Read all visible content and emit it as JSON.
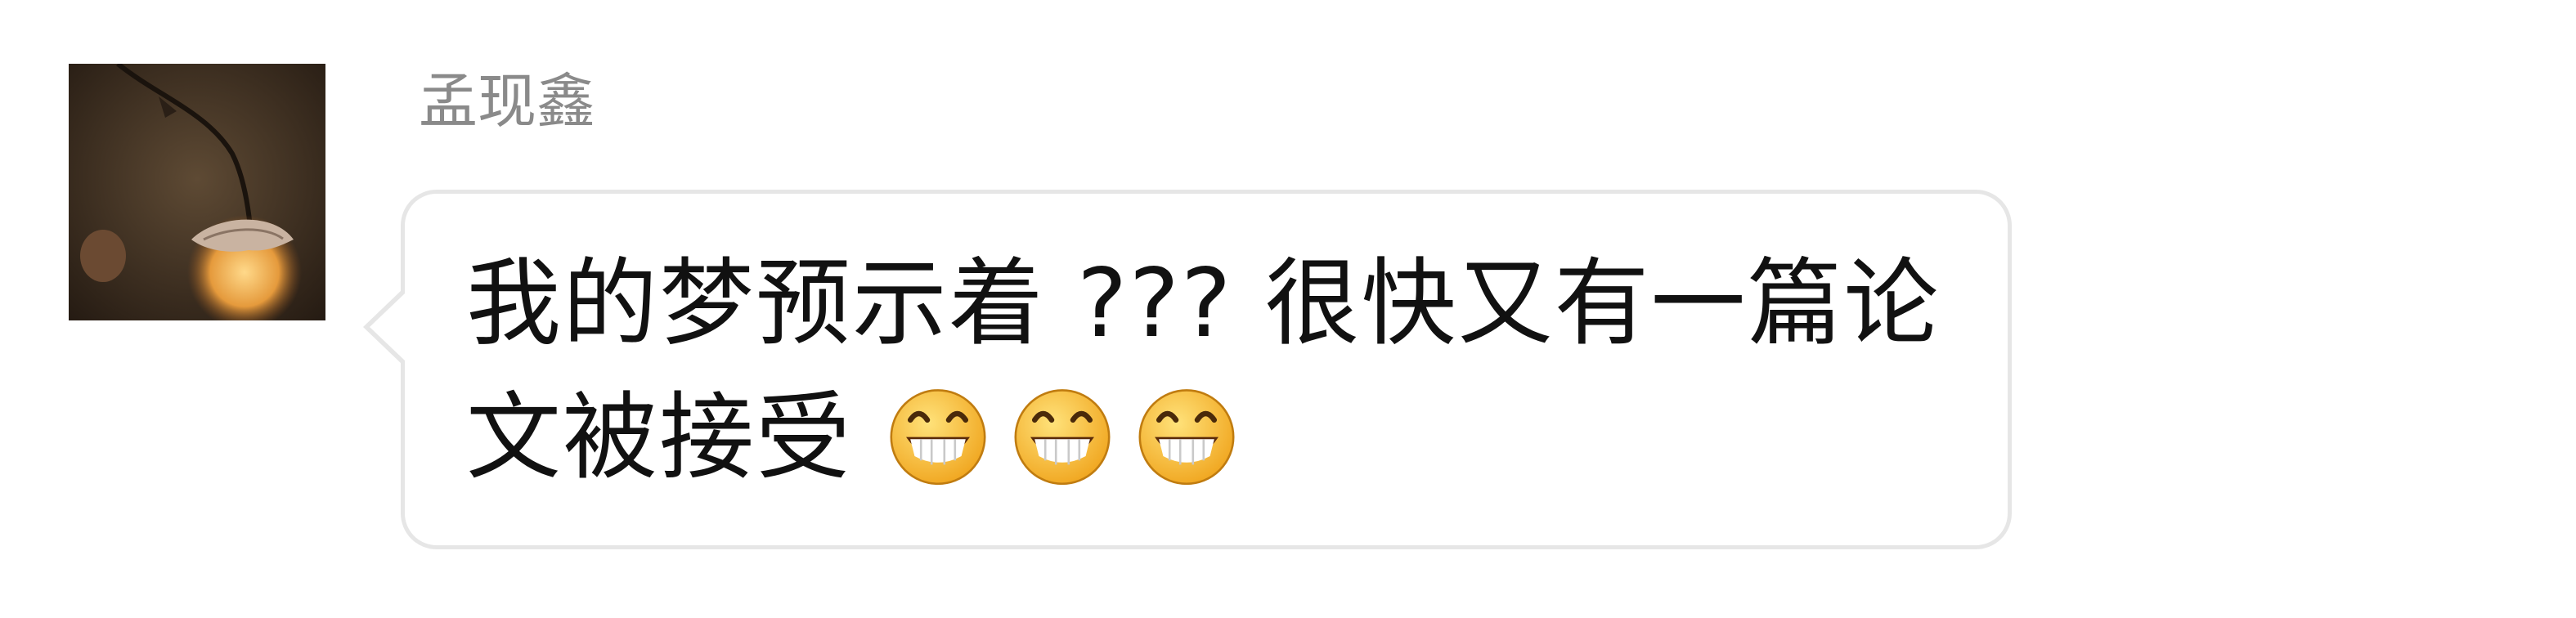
{
  "message": {
    "sender_name": "孟现鑫",
    "line1": "我的梦预示着 ??? 很快又有一篇论",
    "line2": "文被接受",
    "emojis": [
      "grin-emoji",
      "grin-emoji",
      "grin-emoji"
    ]
  },
  "colors": {
    "sender_text": "#8a8a8a",
    "bubble_border": "#e6e6e6",
    "bubble_fill": "#ffffff",
    "message_text": "#111111",
    "emoji_yellow": "#f7c43a"
  }
}
